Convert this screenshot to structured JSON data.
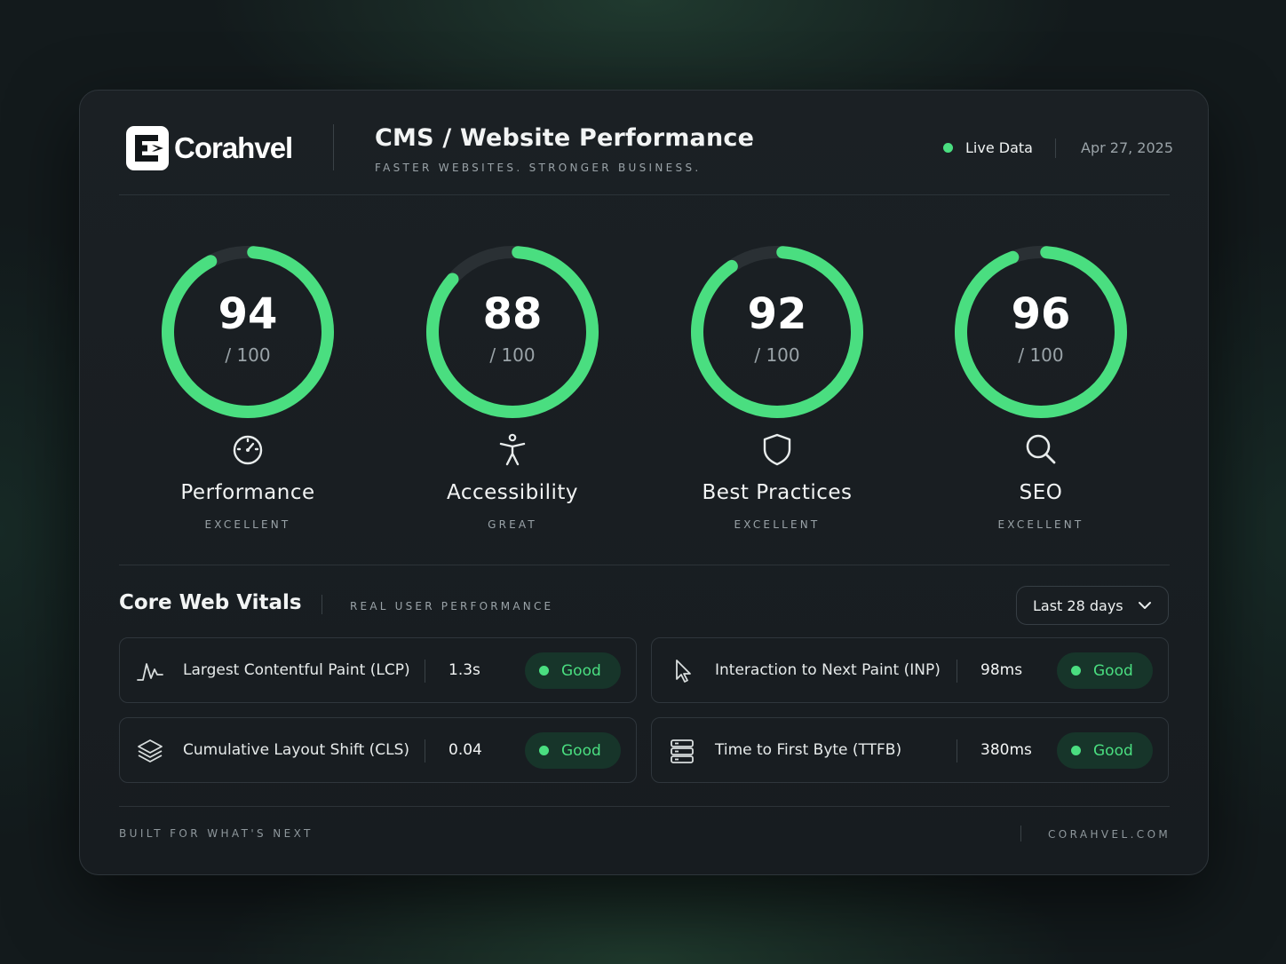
{
  "brand": {
    "name": "Corahvel",
    "logo_icon": "corahvel-logo-icon"
  },
  "header": {
    "title": "CMS / Website Performance",
    "subtitle": "FASTER WEBSITES. STRONGER BUSINESS.",
    "live_label": "Live Data",
    "date": "Apr 27, 2025"
  },
  "colors": {
    "accent": "#4ade80",
    "track": "#2a3034",
    "background": "#131a1c",
    "card": "#1b2024"
  },
  "scores": [
    {
      "score": "94",
      "out_of": "/ 100",
      "value_fraction": 0.94,
      "name": "Performance",
      "grade": "EXCELLENT",
      "icon": "speedometer-icon"
    },
    {
      "score": "88",
      "out_of": "/ 100",
      "value_fraction": 0.88,
      "name": "Accessibility",
      "grade": "GREAT",
      "icon": "accessibility-icon"
    },
    {
      "score": "92",
      "out_of": "/ 100",
      "value_fraction": 0.92,
      "name": "Best Practices",
      "grade": "EXCELLENT",
      "icon": "shield-icon"
    },
    {
      "score": "96",
      "out_of": "/ 100",
      "value_fraction": 0.96,
      "name": "SEO",
      "grade": "EXCELLENT",
      "icon": "search-icon"
    }
  ],
  "vitals_section": {
    "title": "Core Web Vitals",
    "subtitle": "REAL USER PERFORMANCE",
    "range": "Last 28 days",
    "range_icon": "chevron-down-icon"
  },
  "vitals": [
    {
      "name": "Largest Contentful Paint (LCP)",
      "value": "1.3s",
      "status": "Good",
      "icon": "pulse-icon"
    },
    {
      "name": "Interaction to Next Paint (INP)",
      "value": "98ms",
      "status": "Good",
      "icon": "cursor-icon"
    },
    {
      "name": "Cumulative Layout Shift (CLS)",
      "value": "0.04",
      "status": "Good",
      "icon": "layers-icon"
    },
    {
      "name": "Time to First Byte (TTFB)",
      "value": "380ms",
      "status": "Good",
      "icon": "server-icon"
    }
  ],
  "footer": {
    "tagline": "BUILT FOR WHAT'S NEXT",
    "website": "CORAHVEL.COM"
  }
}
